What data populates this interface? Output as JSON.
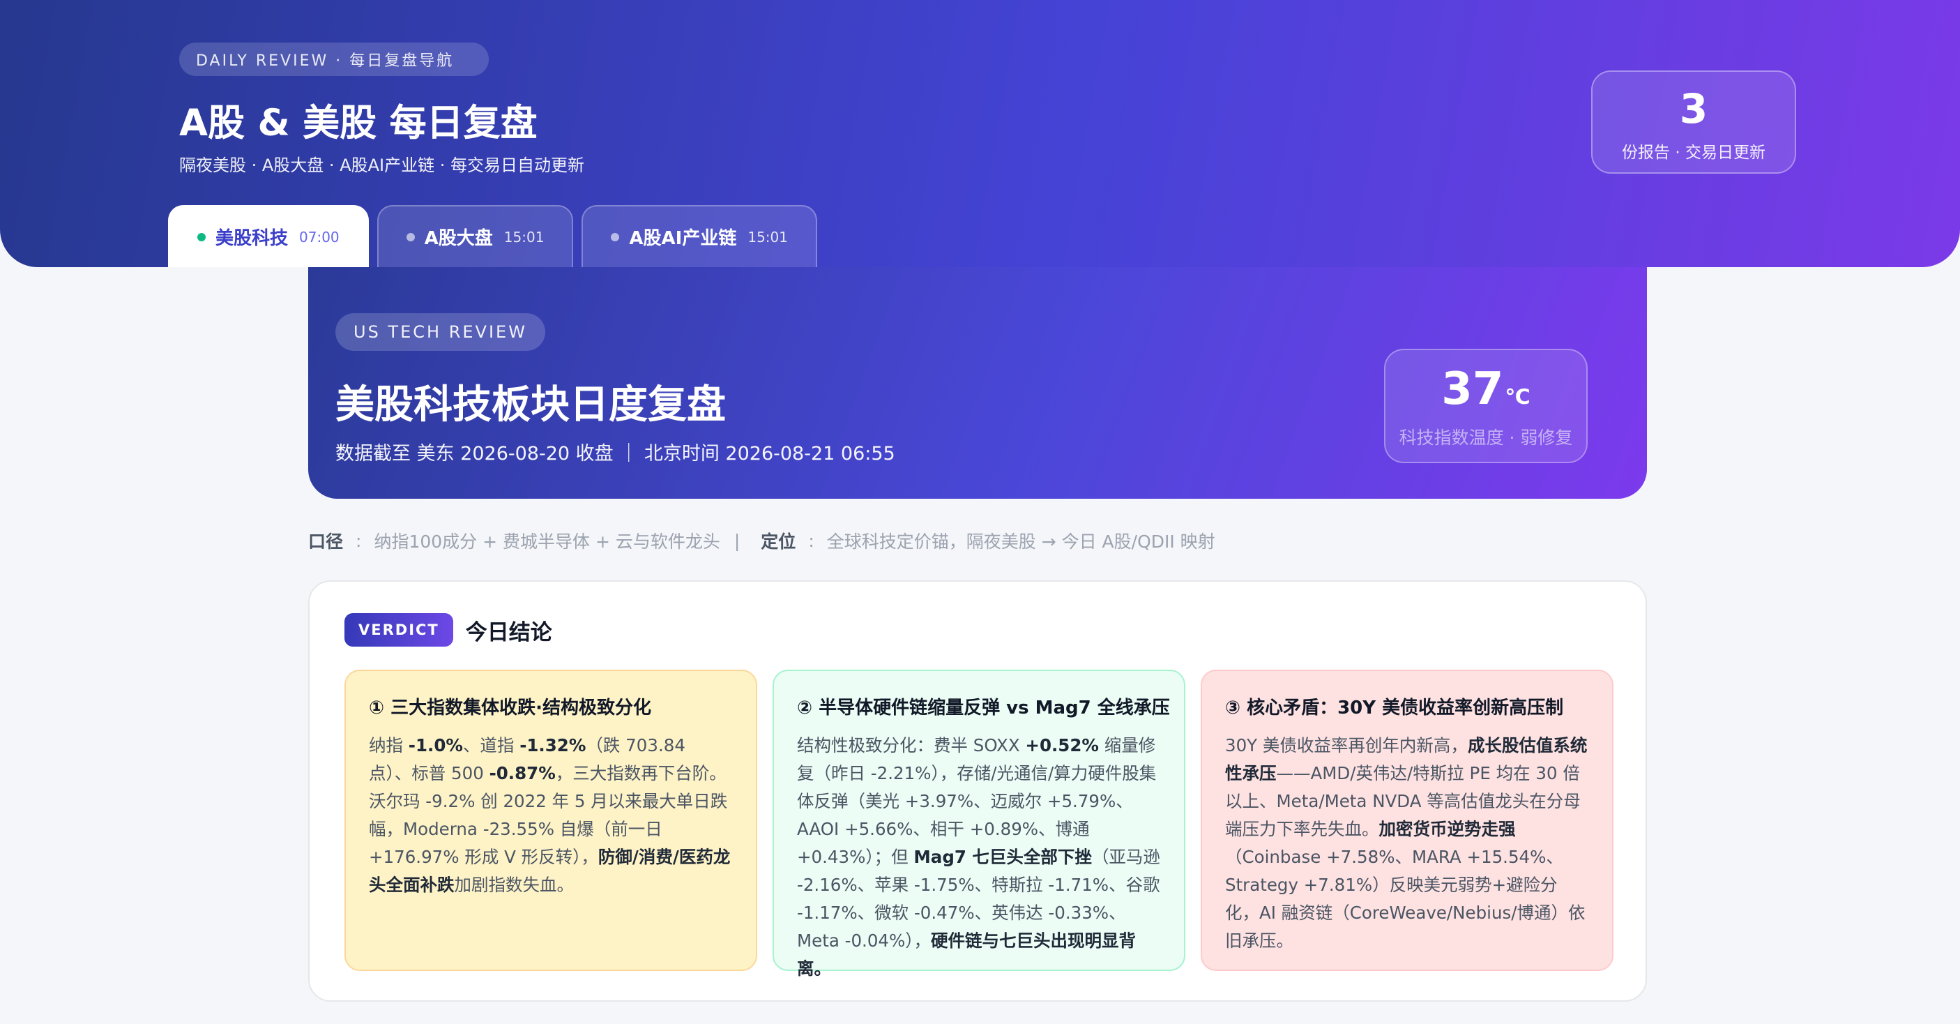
{
  "header": {
    "eyebrow": "DAILY REVIEW · 每日复盘导航",
    "title": "A股 & 美股 每日复盘",
    "subtitle": "隔夜美股 · A股大盘 · A股AI产业链 · 每交易日自动更新",
    "report_count": "3",
    "report_count_label": "份报告 · 交易日更新"
  },
  "tabs": [
    {
      "label": "美股科技",
      "time": "07:00",
      "active": true
    },
    {
      "label": "A股大盘",
      "time": "15:01",
      "active": false
    },
    {
      "label": "A股AI产业链",
      "time": "15:01",
      "active": false
    }
  ],
  "hero": {
    "eyebrow": "US TECH REVIEW",
    "title": "美股科技板块日度复盘",
    "meta": "数据截至 美东 2026-08-20 收盘 ｜ 北京时间 2026-08-21 06:55",
    "temperature": "37",
    "temperature_unit": "℃",
    "temperature_label": "科技指数温度 · 弱修复"
  },
  "scope": {
    "label1": "口径",
    "value1": "纳指100成分 + 费城半导体 + 云与软件龙头",
    "label2": "定位",
    "value2": "全球科技定价锚，隔夜美股 → 今日 A股/QDII 映射"
  },
  "verdict": {
    "badge": "VERDICT",
    "title": "今日结论",
    "items": [
      {
        "heading": "① 三大指数集体收跌·结构极致分化",
        "parts": [
          {
            "t": "纳指 "
          },
          {
            "t": "-1.0%",
            "b": true
          },
          {
            "t": "、道指 "
          },
          {
            "t": "-1.32%",
            "b": true
          },
          {
            "t": "（跌 703.84 点）、标普 500 "
          },
          {
            "t": "-0.87%",
            "b": true
          },
          {
            "t": "，三大指数再下台阶。沃尔玛 -9.2% 创 2022 年 5 月以来最大单日跌幅，Moderna -23.55% 自爆（前一日 +176.97% 形成 V 形反转），"
          },
          {
            "t": "防御/消费/医药龙头全面补跌",
            "b": true
          },
          {
            "t": "加剧指数失血。"
          }
        ]
      },
      {
        "heading": "② 半导体硬件链缩量反弹 vs Mag7 全线承压",
        "parts": [
          {
            "t": "结构性极致分化：费半 SOXX "
          },
          {
            "t": "+0.52%",
            "b": true
          },
          {
            "t": " 缩量修复（昨日 -2.21%），存储/光通信/算力硬件股集体反弹（美光 +3.97%、迈威尔 +5.79%、AAOI +5.66%、相干 +0.89%、博通 +0.43%）；但 "
          },
          {
            "t": "Mag7 七巨头全部下挫",
            "b": true
          },
          {
            "t": "（亚马逊 -2.16%、苹果 -1.75%、特斯拉 -1.71%、谷歌 -1.17%、微软 -0.47%、英伟达 -0.33%、Meta -0.04%），"
          },
          {
            "t": "硬件链与七巨头出现明显背离。",
            "b": true
          }
        ]
      },
      {
        "heading": "③ 核心矛盾：30Y 美债收益率创新高压制",
        "parts": [
          {
            "t": "30Y 美债收益率再创年内新高，"
          },
          {
            "t": "成长股估值系统性承压",
            "b": true
          },
          {
            "t": "——AMD/英伟达/特斯拉 PE 均在 30 倍以上、Meta/Meta NVDA 等高估值龙头在分母端压力下率先失血。"
          },
          {
            "t": "加密货币逆势走强",
            "b": true
          },
          {
            "t": "（Coinbase +7.58%、MARA +15.54%、Strategy +7.81%）反映美元弱势+避险分化，AI 融资链（CoreWeave/Nebius/博通）依旧承压。"
          }
        ]
      }
    ]
  }
}
